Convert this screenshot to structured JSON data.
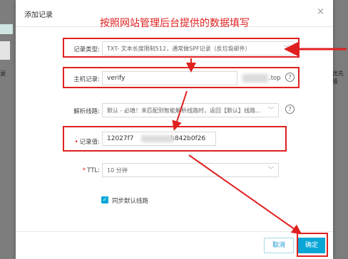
{
  "background": {
    "left_text": "录",
    "right_text": "优先级"
  },
  "dialog": {
    "title": "添加记录",
    "close_label": "×",
    "annotation": "按照网站管理后台提供的数据填写"
  },
  "form": {
    "record_type": {
      "label": "记录类型:",
      "value": "TXT- 文本长度限制512，通常做SPF记录（反垃圾邮件）"
    },
    "host": {
      "label": "主机记录:",
      "value": "verify",
      "suffix": ".top"
    },
    "line": {
      "label": "解析线路:",
      "value": "默认 - 必填！未匹配到智能解析线路时，返回【默认】线路..."
    },
    "record_value": {
      "label": "记录值:",
      "value_start": "12027f7",
      "value_end": "b842b0f26"
    },
    "ttl": {
      "label": "TTL:",
      "value": "10 分钟"
    },
    "sync": {
      "label": "同步默认线路",
      "checked": true
    }
  },
  "footer": {
    "cancel_label": "取消",
    "ok_label": "确定"
  },
  "colors": {
    "accent": "#0aa6d6",
    "annotation_red": "#e02020"
  }
}
